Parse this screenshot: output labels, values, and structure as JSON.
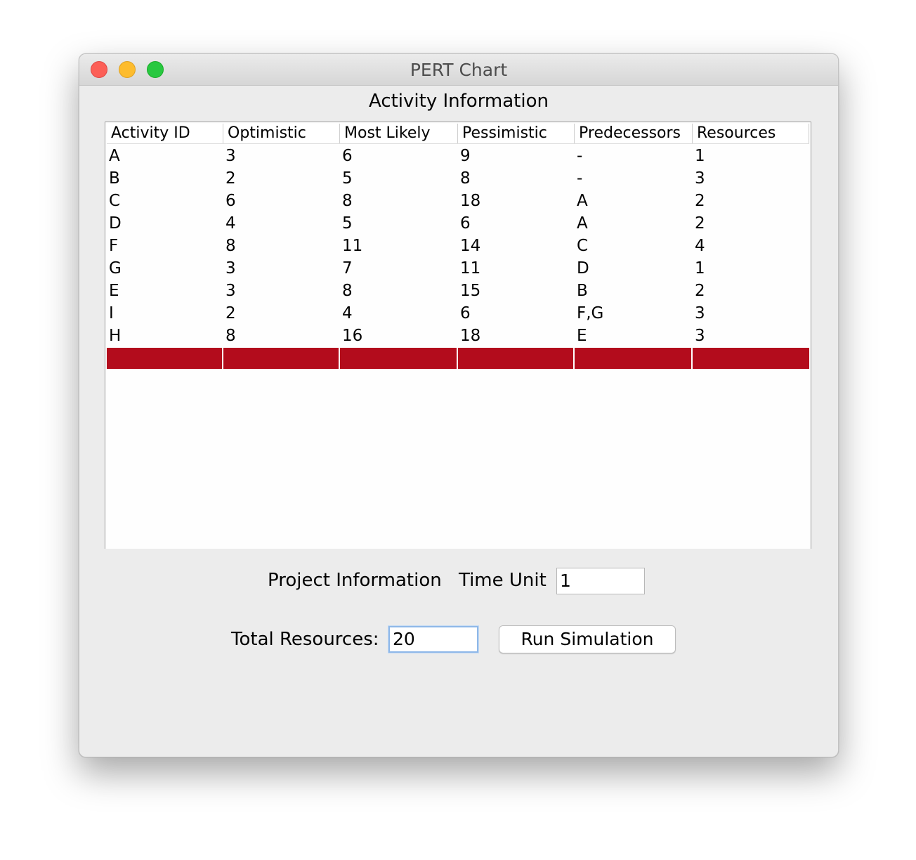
{
  "window": {
    "title": "PERT Chart"
  },
  "activity_section": {
    "title": "Activity Information"
  },
  "table": {
    "columns": [
      "Activity ID",
      "Optimistic",
      "Most Likely",
      "Pessimistic",
      "Predecessors",
      "Resources"
    ],
    "rows": [
      [
        "A",
        "3",
        "6",
        "9",
        "-",
        "1"
      ],
      [
        "B",
        "2",
        "5",
        "8",
        "-",
        "3"
      ],
      [
        "C",
        "6",
        "8",
        "18",
        "A",
        "2"
      ],
      [
        "D",
        "4",
        "5",
        "6",
        "A",
        "2"
      ],
      [
        "F",
        "8",
        "11",
        "14",
        "C",
        "4"
      ],
      [
        "G",
        "3",
        "7",
        "11",
        "D",
        "1"
      ],
      [
        "E",
        "3",
        "8",
        "15",
        "B",
        "2"
      ],
      [
        "I",
        "2",
        "4",
        "6",
        "F,G",
        "3"
      ],
      [
        "H",
        "8",
        "16",
        "18",
        "E",
        "3"
      ]
    ],
    "selected_row": [
      "",
      "",
      "",
      "",
      "",
      ""
    ],
    "selection_color": "#b30c1c"
  },
  "project": {
    "label": "Project Information",
    "time_unit_label": "Time Unit",
    "time_unit_value": "1",
    "total_resources_label": "Total Resources:",
    "total_resources_value": "20",
    "run_button_label": "Run Simulation"
  },
  "colors": {
    "window_bg": "#ececec",
    "close": "#fc5f57",
    "minimize": "#fdbc2e",
    "maximize": "#28c840",
    "focus_ring": "#8fb8e8"
  }
}
